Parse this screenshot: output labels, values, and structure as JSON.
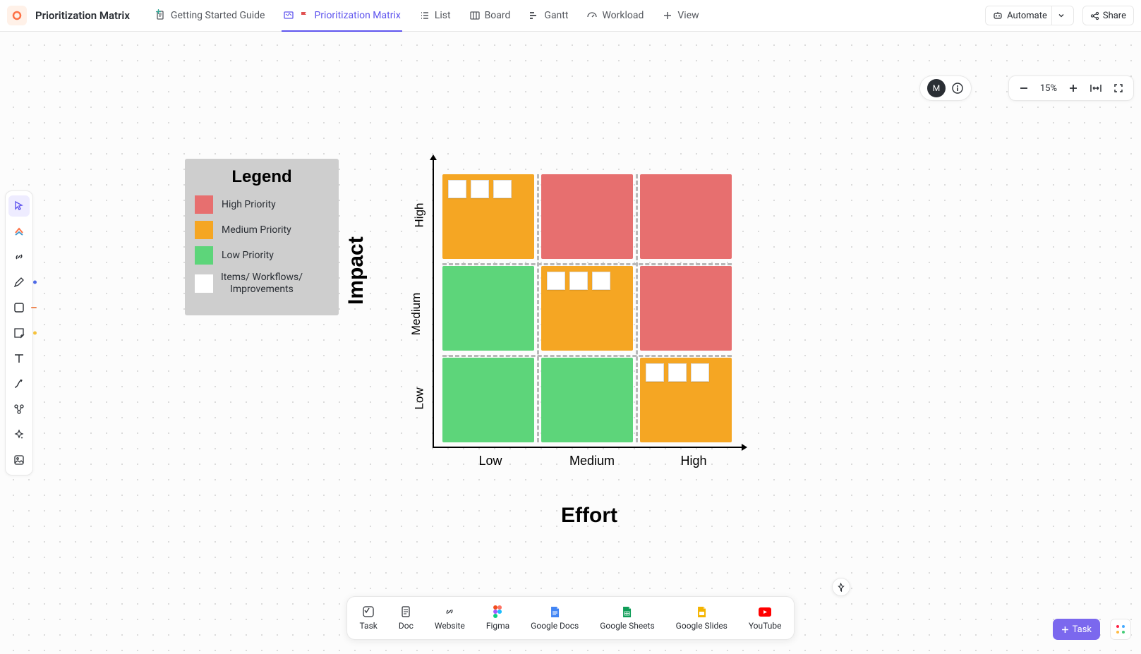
{
  "header": {
    "title": "Prioritization Matrix",
    "tabs": [
      {
        "label": "Getting Started Guide",
        "active": false,
        "icon": "doc"
      },
      {
        "label": "Prioritization Matrix",
        "active": true,
        "icon": "whiteboard"
      },
      {
        "label": "List",
        "active": false,
        "icon": "list"
      },
      {
        "label": "Board",
        "active": false,
        "icon": "board"
      },
      {
        "label": "Gantt",
        "active": false,
        "icon": "gantt"
      },
      {
        "label": "Workload",
        "active": false,
        "icon": "workload"
      },
      {
        "label": "View",
        "active": false,
        "icon": "plus"
      }
    ],
    "automate": "Automate",
    "share": "Share"
  },
  "toolbar_left": [
    "select",
    "clickup",
    "link",
    "pen",
    "shape",
    "sticky",
    "text",
    "connector",
    "diagram",
    "ai",
    "image"
  ],
  "avatars": {
    "initial": "M"
  },
  "zoom": {
    "level": "15%"
  },
  "legend": {
    "title": "Legend",
    "items": [
      {
        "color": "#e76f6f",
        "label": "High Priority"
      },
      {
        "color": "#f5a623",
        "label": "Medium Priority"
      },
      {
        "color": "#5dd57a",
        "label": "Low Priority"
      },
      {
        "color": "#ffffff",
        "label": "Items/ Workflows/ Improvements"
      }
    ]
  },
  "matrix": {
    "y_title": "Impact",
    "x_title": "Effort",
    "y_labels": [
      "High",
      "Medium",
      "Low"
    ],
    "x_labels": [
      "Low",
      "Medium",
      "High"
    ],
    "cells": [
      {
        "row": 0,
        "col": 0,
        "priority": "medium",
        "has_items": true
      },
      {
        "row": 0,
        "col": 1,
        "priority": "high",
        "has_items": false
      },
      {
        "row": 0,
        "col": 2,
        "priority": "high",
        "has_items": false
      },
      {
        "row": 1,
        "col": 0,
        "priority": "low",
        "has_items": false
      },
      {
        "row": 1,
        "col": 1,
        "priority": "medium",
        "has_items": true
      },
      {
        "row": 1,
        "col": 2,
        "priority": "high",
        "has_items": false
      },
      {
        "row": 2,
        "col": 0,
        "priority": "low",
        "has_items": false
      },
      {
        "row": 2,
        "col": 1,
        "priority": "low",
        "has_items": false
      },
      {
        "row": 2,
        "col": 2,
        "priority": "medium",
        "has_items": true
      }
    ]
  },
  "dock": [
    {
      "label": "Task",
      "icon": "task"
    },
    {
      "label": "Doc",
      "icon": "doc2"
    },
    {
      "label": "Website",
      "icon": "website"
    },
    {
      "label": "Figma",
      "icon": "figma"
    },
    {
      "label": "Google Docs",
      "icon": "gdocs"
    },
    {
      "label": "Google Sheets",
      "icon": "gsheets"
    },
    {
      "label": "Google Slides",
      "icon": "gslides"
    },
    {
      "label": "YouTube",
      "icon": "youtube"
    }
  ],
  "task_button": "Task",
  "colors": {
    "accent": "#7b68ee",
    "high": "#e76f6f",
    "medium": "#f5a623",
    "low": "#5dd57a"
  }
}
